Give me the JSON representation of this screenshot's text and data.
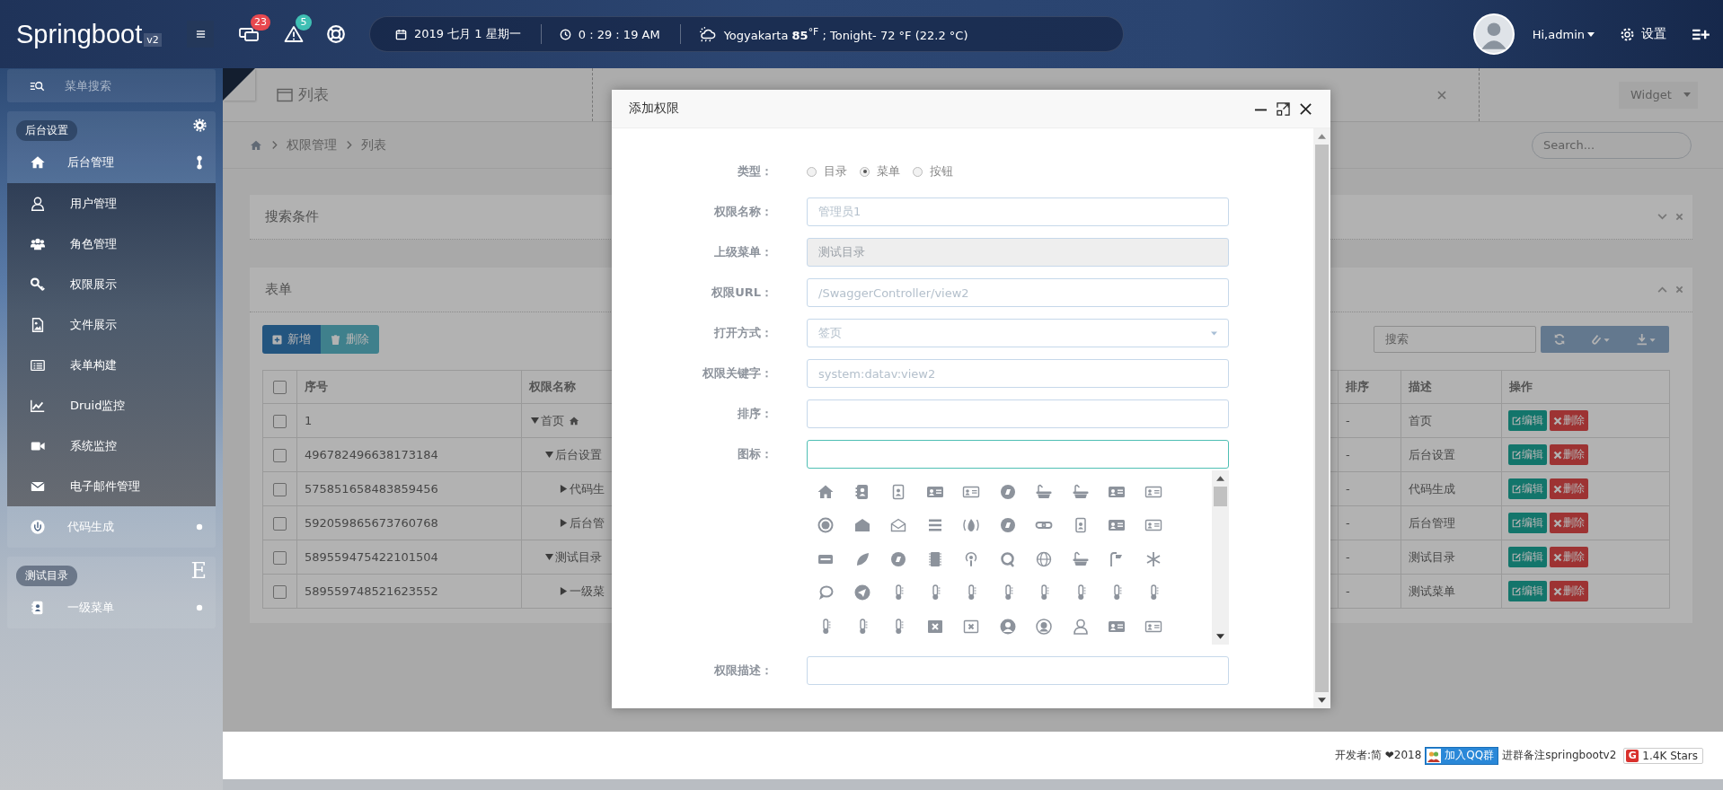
{
  "topbar": {
    "logo": "Springboot",
    "version": "v2",
    "notifications": [
      {
        "count": "23",
        "color": "#e8484f"
      },
      {
        "count": "5",
        "color": "#3fbfb4"
      }
    ],
    "date": "2019 七月 1 星期一",
    "time": "0 : 29 : 19 AM",
    "weather": "Yogyakarta **85**$^{°F}$ ; Tonight- 72 °F (22.2 °C)",
    "user": "Hi,admin",
    "settings": "设置"
  },
  "sidebar": {
    "search_placeholder": "菜单搜索",
    "groups": [
      {
        "title": "后台设置",
        "items": [
          {
            "label": "后台管理",
            "expanded": true,
            "children": [
              {
                "label": "用户管理"
              },
              {
                "label": "角色管理"
              },
              {
                "label": "权限展示"
              },
              {
                "label": "文件展示"
              },
              {
                "label": "表单构建"
              },
              {
                "label": "Druid监控"
              },
              {
                "label": "系统监控"
              },
              {
                "label": "电子邮件管理"
              }
            ]
          },
          {
            "label": "代码生成",
            "expanded": false
          }
        ]
      },
      {
        "title": "测试目录",
        "glyph": "E",
        "items": [
          {
            "label": "一级菜单",
            "expanded": false
          }
        ]
      }
    ]
  },
  "tabs": [
    {
      "label": "列表",
      "closable": false
    },
    {
      "closable": true
    }
  ],
  "widget": "Widget",
  "breadcrumb": [
    "权限管理",
    "列表"
  ],
  "search_placeholder": "Search...",
  "search_panel": {
    "title": "搜索条件",
    "expanded": false
  },
  "table_panel": {
    "title": "表单",
    "expanded": true,
    "buttons": [
      "新增",
      "删除"
    ],
    "search_placeholder": "搜索"
  },
  "table": {
    "all_checked": false,
    "columns": [
      "序号",
      "权限名称",
      "排序",
      "描述",
      "操作"
    ],
    "rows": [
      {
        "id": "1",
        "name": "首页",
        "expanded": true,
        "checked": false,
        "sort": "-",
        "desc": "首页",
        "actions": [
          "编辑",
          "删除"
        ],
        "children": [
          {
            "id": "496782496638173184",
            "name": "后台设置",
            "expanded": true,
            "checked": false,
            "sort": "-",
            "desc": "后台设置",
            "actions": [
              "编辑",
              "删除"
            ],
            "children": [
              {
                "id": "575851658483859456",
                "name": "代码生",
                "expanded": false,
                "checked": false,
                "sort": "-",
                "desc": "代码生成",
                "actions": [
                  "编辑",
                  "删除"
                ]
              },
              {
                "id": "592059865673760768",
                "name": "后台管",
                "expanded": false,
                "checked": false,
                "sort": "-",
                "desc": "后台管理",
                "actions": [
                  "编辑",
                  "删除"
                ]
              }
            ]
          },
          {
            "id": "589559475422101504",
            "name": "测试目录",
            "expanded": true,
            "checked": false,
            "sort": "-",
            "desc": "测试目录",
            "actions": [
              "编辑",
              "删除"
            ],
            "children": [
              {
                "id": "589559748521623552",
                "name": "一级菜",
                "expanded": false,
                "checked": false,
                "sort": "-",
                "desc": "测试菜单",
                "actions": [
                  "编辑",
                  "删除"
                ]
              }
            ]
          }
        ]
      }
    ]
  },
  "modal": {
    "title": "添加权限",
    "fields": [
      {
        "kind": "radio",
        "label": "类型：",
        "options": [
          {
            "label": "目录",
            "selected": false
          },
          {
            "label": "菜单",
            "selected": true
          },
          {
            "label": "按钮",
            "selected": false
          }
        ]
      },
      {
        "kind": "text",
        "label": "权限名称：",
        "placeholder": "管理员1",
        "disabled": false,
        "focused": false
      },
      {
        "kind": "text",
        "label": "上级菜单：",
        "value": "测试目录",
        "disabled": true,
        "focused": false
      },
      {
        "kind": "text",
        "label": "权限URL：",
        "placeholder": "/SwaggerController/view2",
        "disabled": false,
        "focused": false
      },
      {
        "kind": "select",
        "label": "打开方式：",
        "value": "签页"
      },
      {
        "kind": "text",
        "label": "权限关键字：",
        "placeholder": "system:datav:view2",
        "disabled": false,
        "focused": false
      },
      {
        "kind": "text",
        "label": "排序：",
        "disabled": false,
        "focused": false
      },
      {
        "kind": "icon-picker",
        "label": "图标：",
        "disabled": false,
        "focused": true
      },
      {
        "kind": "text",
        "label": "权限描述：",
        "disabled": false,
        "focused": false
      }
    ]
  },
  "footer": {
    "developer": "开发者:简 ❤2018",
    "qq_button": "加入QQ群",
    "note": "进群备注springbootv2",
    "stars_logo": "G",
    "stars": "1.4K Stars"
  }
}
